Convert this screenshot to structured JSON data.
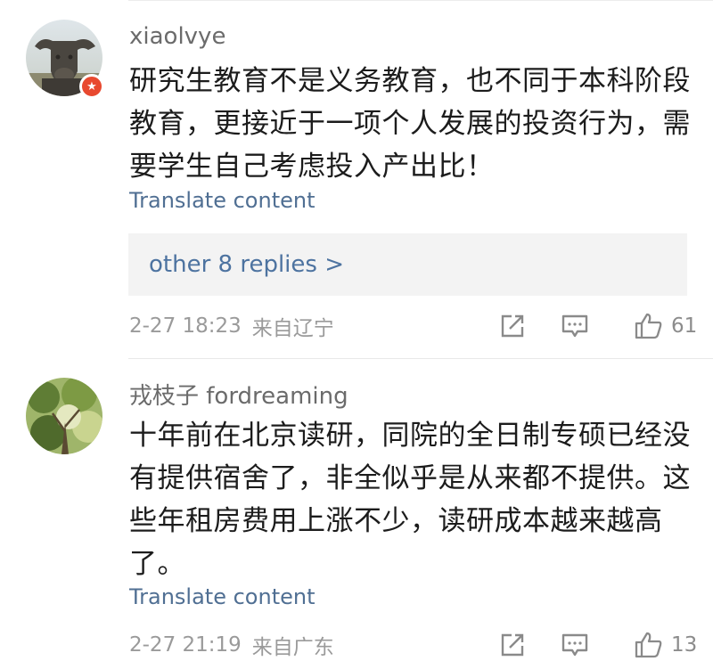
{
  "comments": [
    {
      "username": "xiaolvye",
      "lines": [
        "研究生教育不是义务教育，也不同于本科阶段",
        "教育，更接近于一项个人发展的投资行为，需",
        "要学生自己考虑投入产出比！"
      ],
      "translate_label": "Translate content",
      "replies_label": "other 8 replies >",
      "timestamp": "2-27 18:23",
      "location": "来自辽宁",
      "likes": "61",
      "avatar_icon": "ox-statue-avatar",
      "badge_icon": "verified-badge-icon"
    },
    {
      "username": "戎枝子 fordreaming",
      "lines": [
        "十年前在北京读研，同院的全日制专硕已经没",
        "有提供宿舍了，非全似乎是从来都不提供。这",
        "些年租房费用上涨不少，读研成本越来越高",
        "了。"
      ],
      "translate_label": "Translate content",
      "timestamp": "2-27 21:19",
      "location": "来自广东",
      "likes": "13",
      "avatar_icon": "tree-photo-avatar"
    }
  ],
  "colors": {
    "link": "#506f93",
    "replies_link": "#4d73a0",
    "meta_text": "#9a9a9a",
    "badge": "#e8492f"
  }
}
